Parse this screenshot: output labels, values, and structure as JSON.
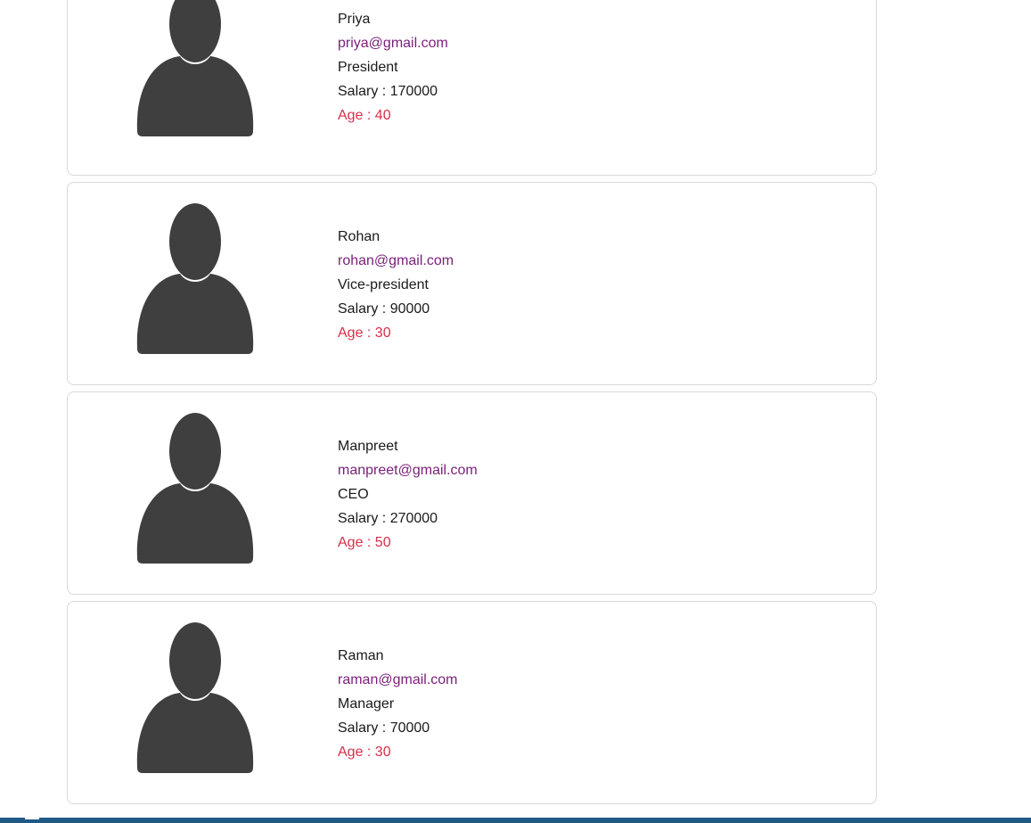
{
  "colors": {
    "name_text": "#1a1a1a",
    "email_text": "#7a1f7a",
    "age_text": "#d6304a",
    "avatar_fill": "#3f3f3f",
    "card_border": "#d9d9d9"
  },
  "employees": [
    {
      "name": "Priya",
      "email": "priya@gmail.com",
      "designation": "President",
      "salary": "Salary : 170000",
      "age": "Age : 40",
      "avatar_icon": "user-silhouette-icon"
    },
    {
      "name": "Rohan",
      "email": "rohan@gmail.com",
      "designation": "Vice-president",
      "salary": "Salary : 90000",
      "age": "Age : 30",
      "avatar_icon": "user-silhouette-icon"
    },
    {
      "name": "Manpreet",
      "email": "manpreet@gmail.com",
      "designation": "CEO",
      "salary": "Salary : 270000",
      "age": "Age : 50",
      "avatar_icon": "user-silhouette-icon"
    },
    {
      "name": "Raman",
      "email": "raman@gmail.com",
      "designation": "Manager",
      "salary": "Salary : 70000",
      "age": "Age : 30",
      "avatar_icon": "user-silhouette-icon"
    }
  ]
}
